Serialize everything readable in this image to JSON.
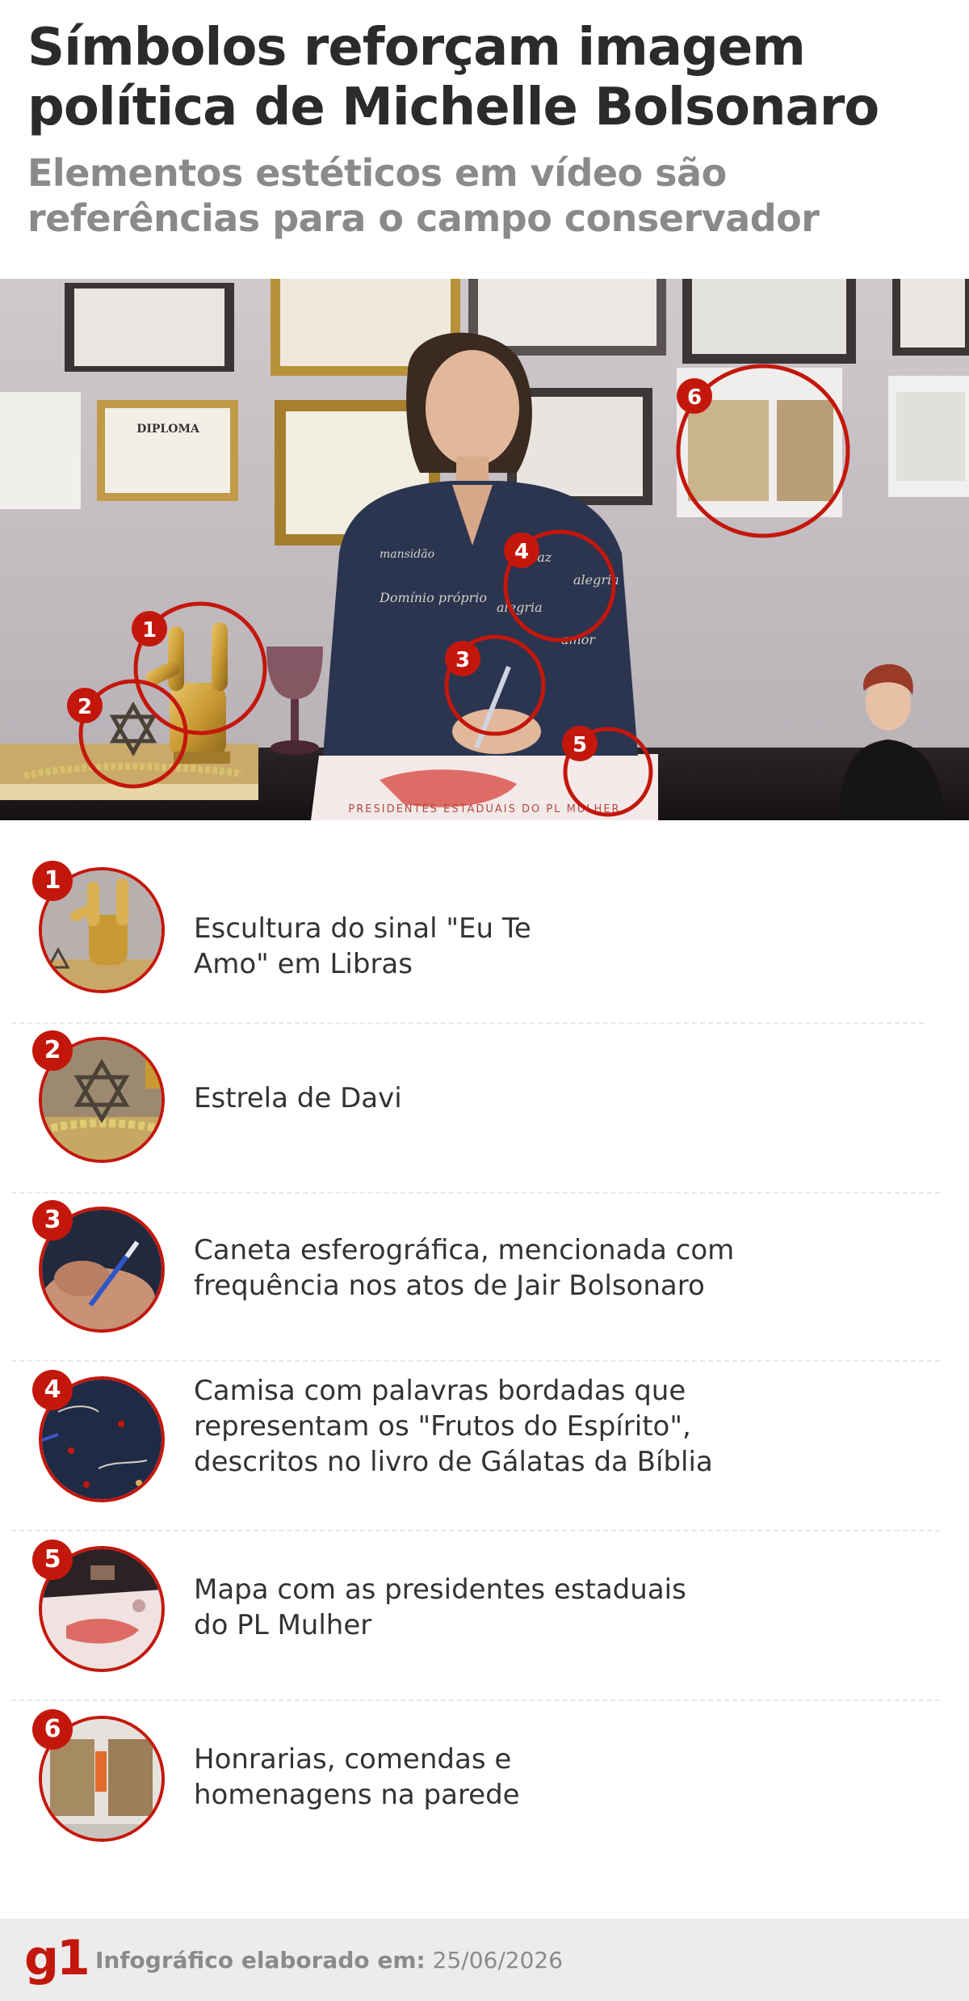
{
  "header": {
    "title": "Símbolos reforçam imagem política de Michelle Bolsonaro",
    "subtitle": "Elementos estéticos em vídeo são referências para o campo conservador"
  },
  "photo": {
    "markers": [
      "1",
      "2",
      "3",
      "4",
      "5",
      "6"
    ],
    "diploma_text": "DIPLOMA",
    "map_caption": "PRESIDENTES ESTADUAIS DO PL MULHER",
    "shirt_words": [
      "alegria",
      "Domínio próprio",
      "paz",
      "amor",
      "mansidão"
    ]
  },
  "items": [
    {
      "number": "1",
      "text": "Escultura do sinal \"Eu Te Amo\" em Libras"
    },
    {
      "number": "2",
      "text": "Estrela de Davi"
    },
    {
      "number": "3",
      "text": "Caneta esferográfica, mencionada com frequência nos atos de Jair Bolsonaro"
    },
    {
      "number": "4",
      "text": "Camisa com palavras bordadas que representam os \"Frutos do Espírito\", descritos no livro de Gálatas da Bíblia"
    },
    {
      "number": "5",
      "text": "Mapa com as presidentes estaduais do PL Mulher"
    },
    {
      "number": "6",
      "text": "Honrarias, comendas e homenagens na parede"
    }
  ],
  "footer": {
    "logo": "g1",
    "credit_label": "Infográfico elaborado em:",
    "credit_date": "25/06/2026"
  },
  "colors": {
    "accent": "#c4170c",
    "title": "#2b2b2b",
    "subtitle": "#8a8a8a",
    "footer_bg": "#ececec"
  }
}
